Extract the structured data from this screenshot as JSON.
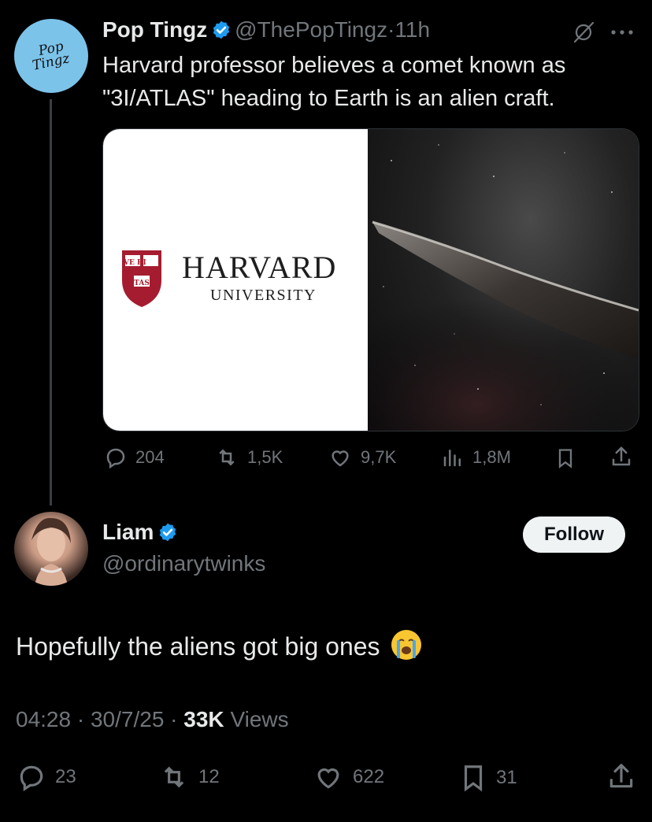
{
  "tweet1": {
    "avatar_text_line1": "Pop",
    "avatar_text_line2": "Tingz",
    "display_name": "Pop Tingz",
    "handle": "@ThePopTingz",
    "separator": "·",
    "time": "11h",
    "text_line1": "Harvard professor believes a comet known as",
    "text_line2": "\"3I/ATLAS\" heading to Earth is an alien craft.",
    "media_left": {
      "title": "HARVARD",
      "subtitle": "UNIVERSITY",
      "shield_top": "VE RI",
      "shield_bottom": "TAS"
    },
    "stats": {
      "replies": "204",
      "reposts": "1,5K",
      "likes": "9,7K",
      "views": "1,8M"
    }
  },
  "tweet2": {
    "display_name": "Liam",
    "handle": "@ordinarytwinks",
    "follow_label": "Follow",
    "text": "Hopefully the aliens got big ones",
    "emoji": "loudly-crying-face",
    "time": "04:28",
    "date": "30/7/25",
    "views_count": "33K",
    "views_label": "Views",
    "separator": "·",
    "stats": {
      "replies": "23",
      "reposts": "12",
      "likes": "622",
      "bookmarks": "31"
    }
  },
  "colors": {
    "background": "#000000",
    "text": "#e7e9ea",
    "muted": "#71767b",
    "verified": "#1d9bf0",
    "harvard_crimson": "#a51c30",
    "avatar_bg": "#7cc3ea"
  }
}
